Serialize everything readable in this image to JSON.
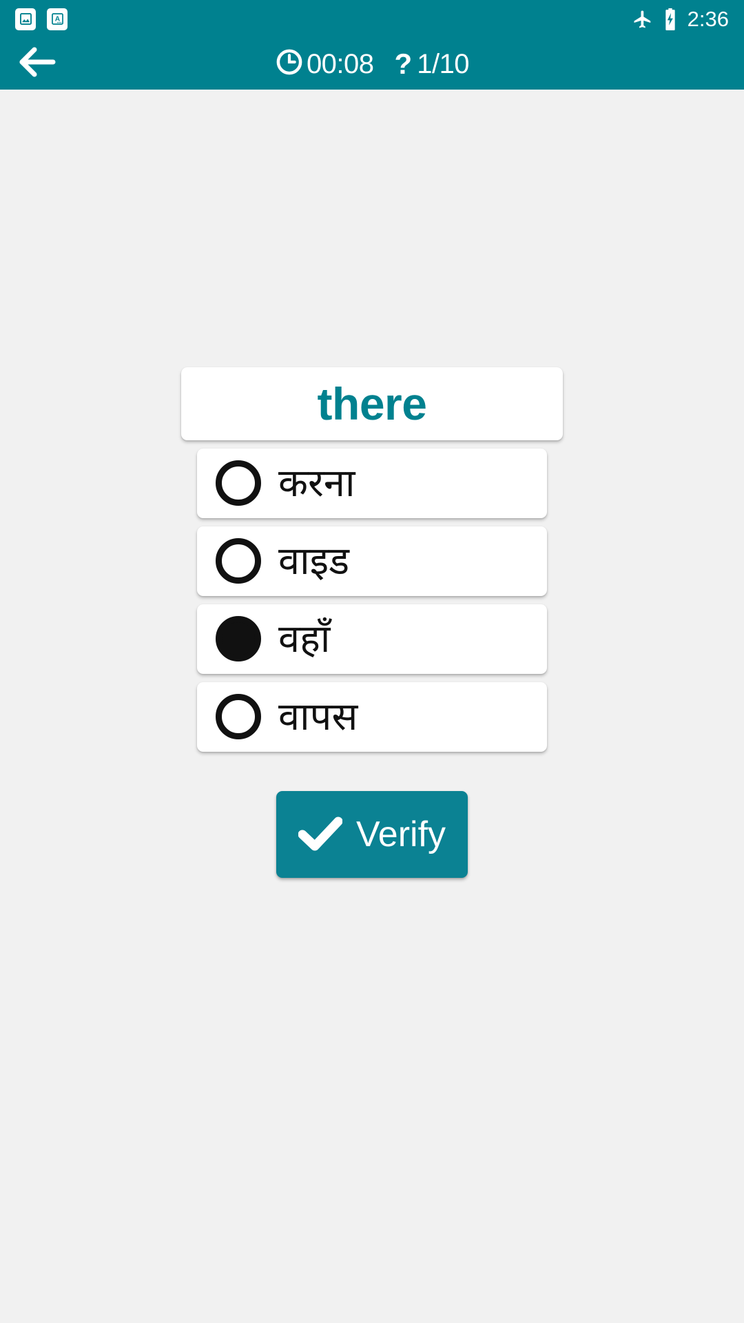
{
  "status_bar": {
    "background_color": "#00818f",
    "left_icons": [
      {
        "name": "image-notification-icon",
        "label": "image"
      },
      {
        "name": "translate-notification-icon",
        "label": "A"
      }
    ],
    "right_icons": [
      {
        "name": "airplane-mode-icon",
        "label": "airplane mode"
      },
      {
        "name": "battery-charging-icon",
        "label": "battery charging"
      }
    ],
    "time": "2:36"
  },
  "app_bar": {
    "background_color": "#00818f",
    "back_icon": "arrow-left-icon",
    "timer_icon": "clock-icon",
    "timer": "00:08",
    "question_icon": "question-mark-icon",
    "progress": "1/10"
  },
  "quiz": {
    "question_word": "there",
    "question_color": "#00818f",
    "selected_index": 2,
    "options": [
      {
        "label": "करना",
        "selected": false
      },
      {
        "label": "वाइड",
        "selected": false
      },
      {
        "label": "वहाँ",
        "selected": true
      },
      {
        "label": "वापस",
        "selected": false
      }
    ],
    "verify_label": "Verify",
    "verify_icon": "checkmark-icon",
    "verify_color": "#0b8293"
  },
  "theme": {
    "background": "#f1f1f1",
    "card_background": "#ffffff",
    "accent": "#00818f",
    "text": "#111111"
  }
}
